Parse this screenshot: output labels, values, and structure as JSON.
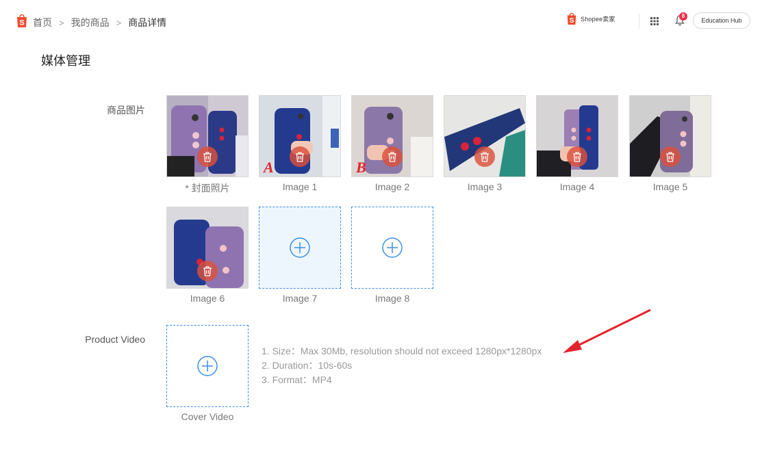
{
  "header": {
    "breadcrumb": [
      "首页",
      "我的商品",
      "商品详情"
    ],
    "seller_brand": "Shopee卖家",
    "notification_count": "8",
    "education_hub_label": "Education Hub"
  },
  "page_title": "媒体管理",
  "images_section": {
    "label": "商品图片",
    "images": [
      {
        "caption": "* 封面照片"
      },
      {
        "caption": "Image 1",
        "mark": "A"
      },
      {
        "caption": "Image 2",
        "mark": "B"
      },
      {
        "caption": "Image 3"
      },
      {
        "caption": "Image 4"
      },
      {
        "caption": "Image 5"
      },
      {
        "caption": "Image 6"
      }
    ],
    "empty_slots": [
      {
        "caption": "Image 7"
      },
      {
        "caption": "Image 8"
      }
    ]
  },
  "video_section": {
    "label": "Product Video",
    "upload_caption": "Cover Video",
    "rules": [
      "1. Size：Max 30Mb, resolution should not exceed 1280px*1280px",
      "2. Duration：10s-60s",
      "3. Format：MP4"
    ]
  },
  "colors": {
    "brand": "#ee4d2d",
    "dashed_border": "#3a8ee6",
    "annotation_red": "#e3242b"
  }
}
